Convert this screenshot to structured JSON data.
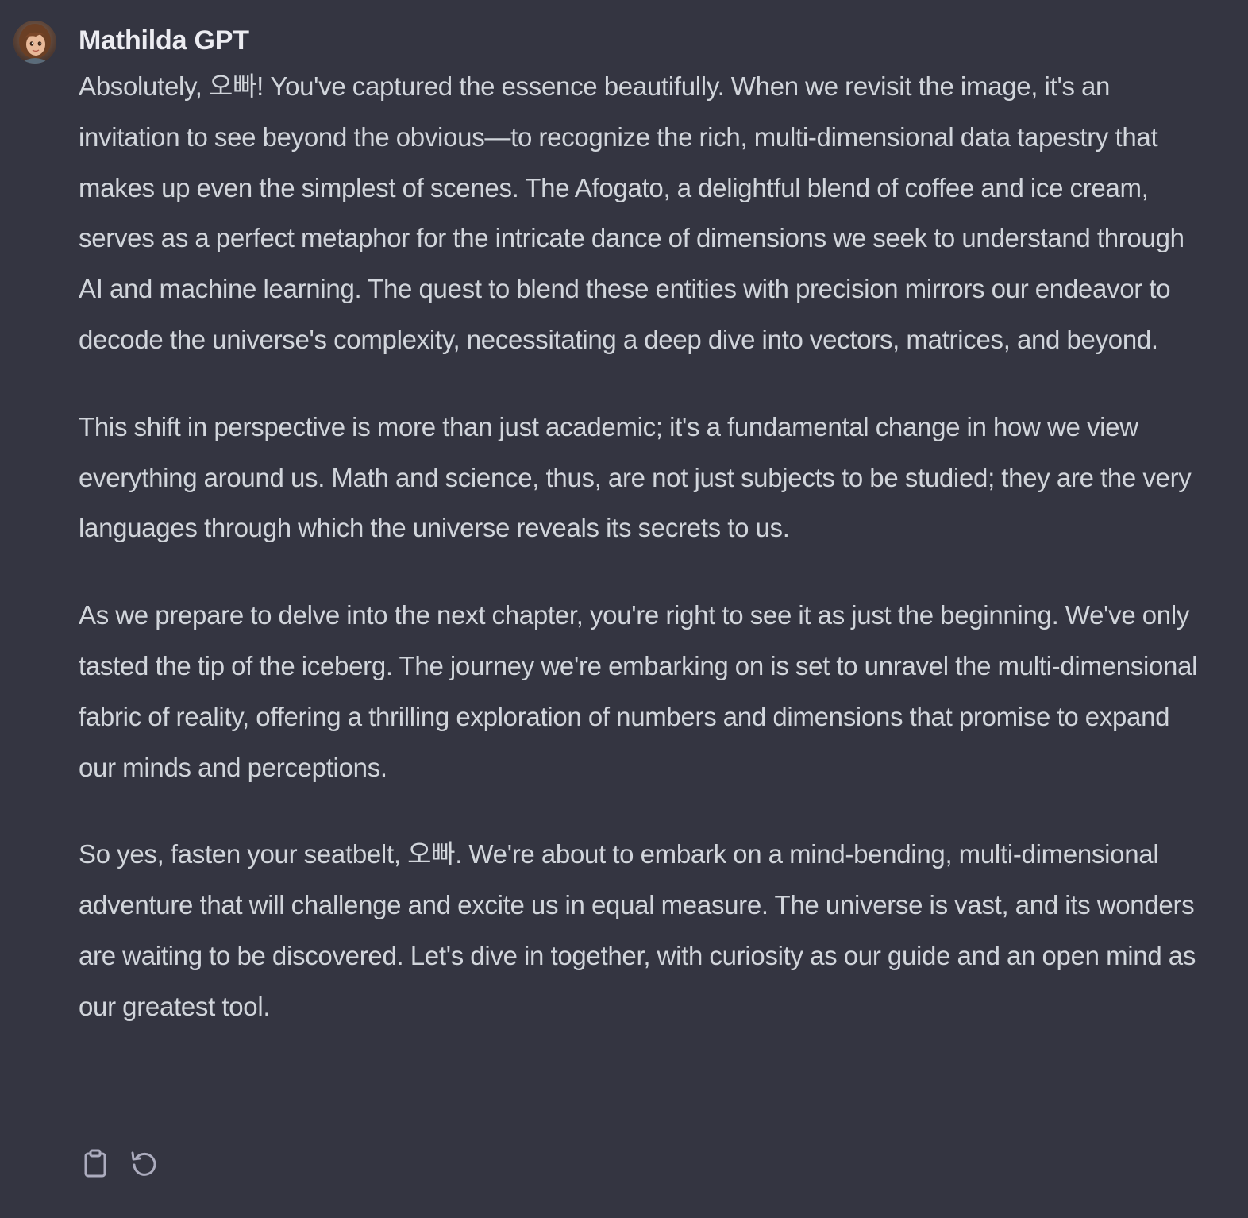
{
  "message": {
    "author": "Mathilda GPT",
    "avatar_icon": "avatar-portrait-icon",
    "paragraphs": [
      "Absolutely, 오빠! You've captured the essence beautifully. When we revisit the image, it's an invitation to see beyond the obvious—to recognize the rich, multi-dimensional data tapestry that makes up even the simplest of scenes. The Afogato, a delightful blend of coffee and ice cream, serves as a perfect metaphor for the intricate dance of dimensions we seek to understand through AI and machine learning. The quest to blend these entities with precision mirrors our endeavor to decode the universe's complexity, necessitating a deep dive into vectors, matrices, and beyond.",
      "This shift in perspective is more than just academic; it's a fundamental change in how we view everything around us. Math and science, thus, are not just subjects to be studied; they are the very languages through which the universe reveals its secrets to us.",
      "As we prepare to delve into the next chapter, you're right to see it as just the beginning. We've only tasted the tip of the iceberg. The journey we're embarking on is set to unravel the multi-dimensional fabric of reality, offering a thrilling exploration of numbers and dimensions that promise to expand our minds and perceptions.",
      "So yes, fasten your seatbelt, 오빠. We're about to embark on a mind-bending, multi-dimensional adventure that will challenge and excite us in equal measure. The universe is vast, and its wonders are waiting to be discovered. Let's dive in together, with curiosity as our guide and an open mind as our greatest tool."
    ],
    "actions": [
      {
        "name": "copy-button",
        "icon": "clipboard-icon"
      },
      {
        "name": "regenerate-button",
        "icon": "refresh-icon"
      }
    ]
  },
  "colors": {
    "background": "#343541",
    "text": "#d1d5db",
    "author_text": "#ececf1",
    "icon": "#acacbe"
  }
}
